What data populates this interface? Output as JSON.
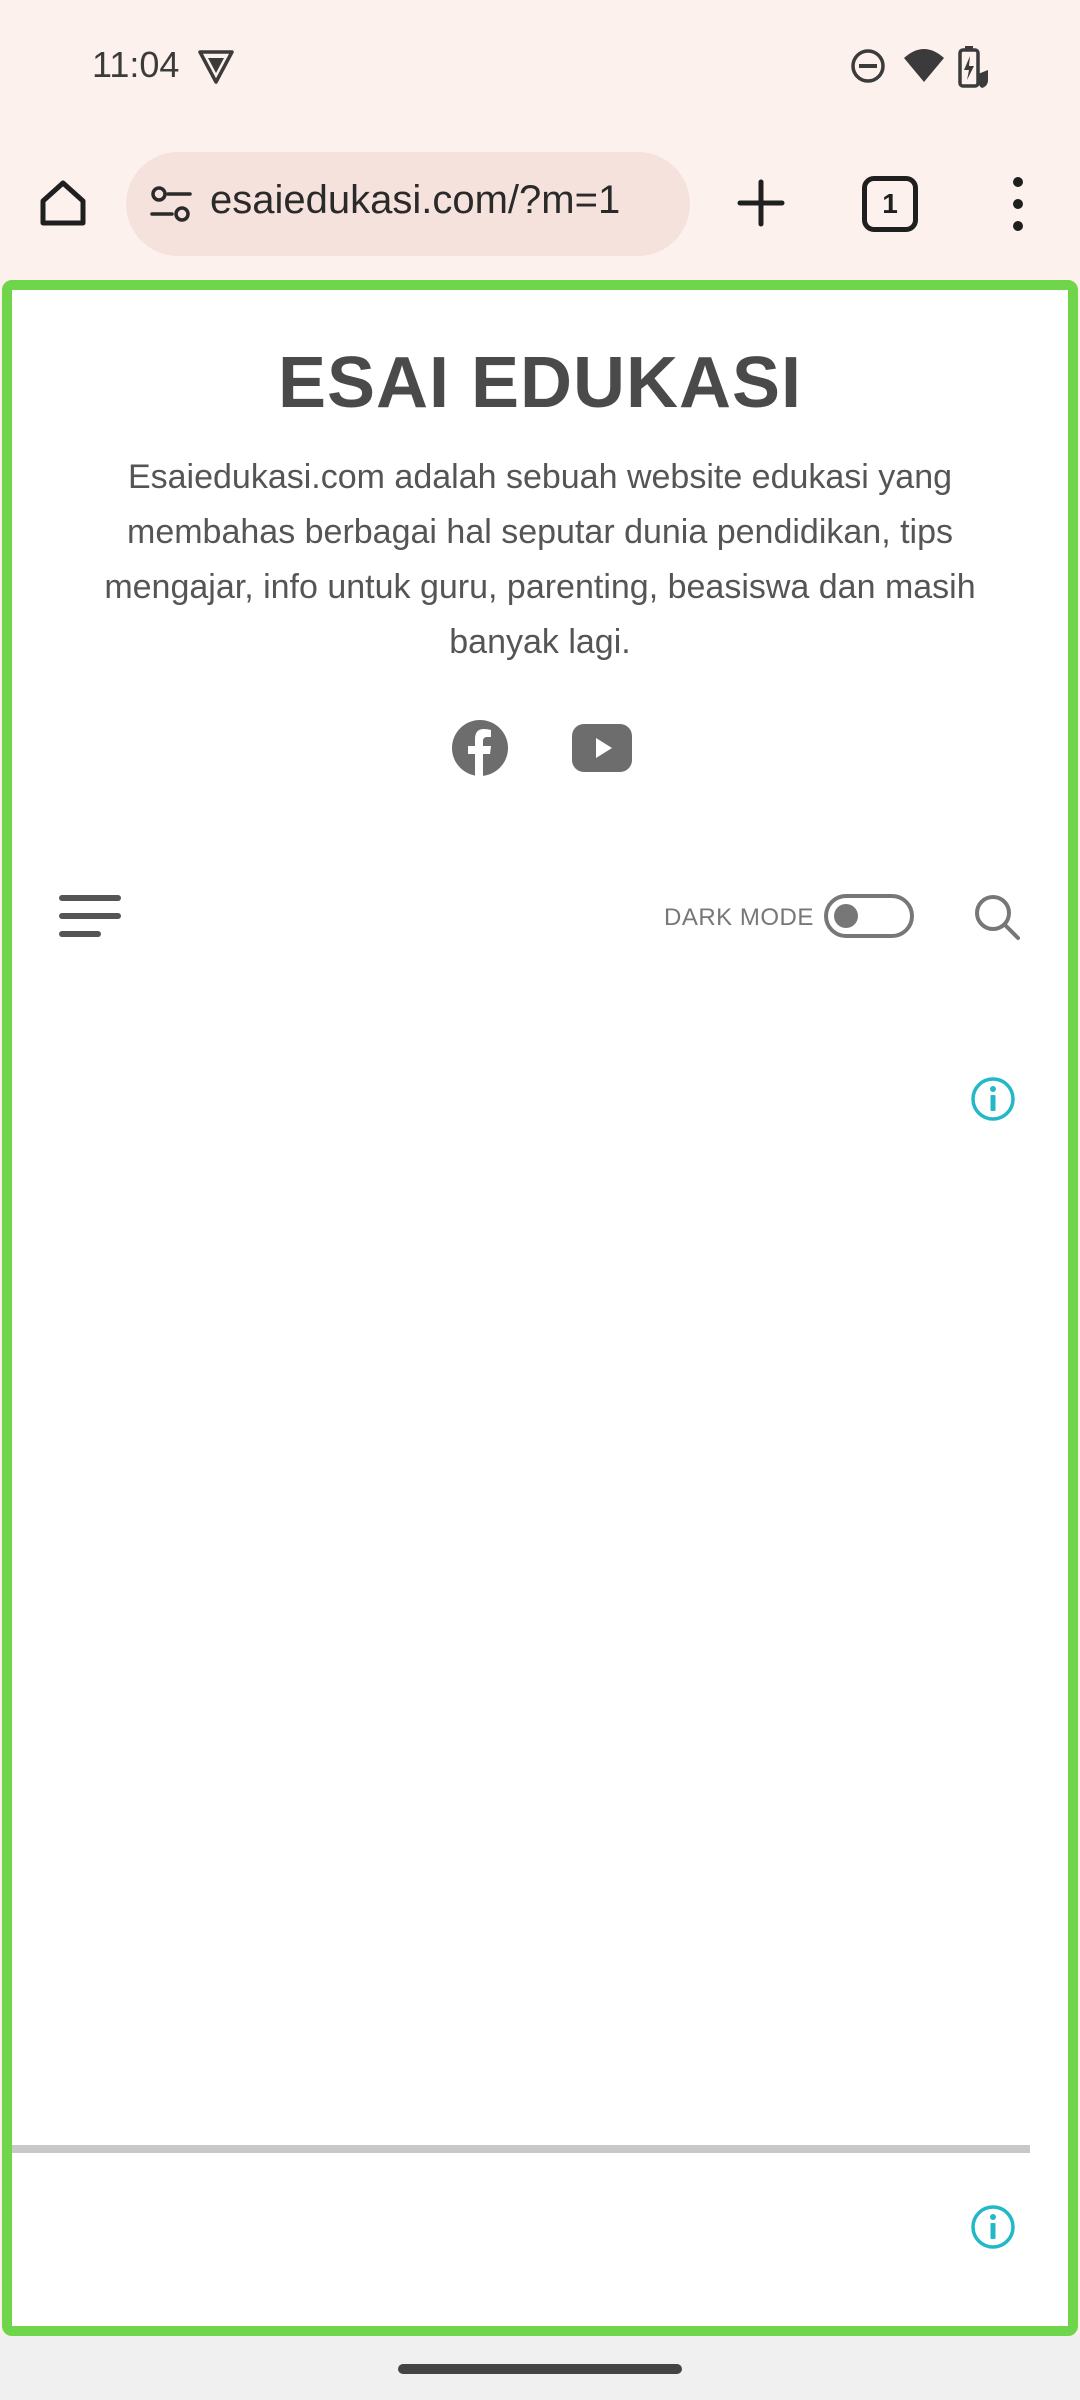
{
  "status_bar": {
    "time": "11:04",
    "icons": [
      "vpn-key-icon",
      "do-not-disturb-icon",
      "wifi-icon",
      "battery-charging-icon"
    ]
  },
  "browser": {
    "url": "esaiedukasi.com/?m=1",
    "tab_count": "1",
    "icons": [
      "home-icon",
      "site-settings-icon",
      "plus-icon",
      "tab-switcher-icon",
      "overflow-menu-icon"
    ]
  },
  "site": {
    "title": "ESAI EDUKASI",
    "description": "Esaiedukasi.com adalah sebuah website edukasi yang membahas berbagai hal seputar dunia pendidikan, tips mengajar, info untuk guru, parenting, beasiswa dan masih banyak lagi.",
    "social_icons": [
      "facebook-icon",
      "youtube-icon"
    ],
    "dark_mode_label": "DARK MODE",
    "dark_mode_on": false
  },
  "colors": {
    "frame_border": "#6fd64b",
    "browser_bg": "#fdf1ee",
    "url_bar_bg": "#f6e2dc",
    "info_icon": "#22b8c8",
    "text_gray": "#4a4a4a"
  }
}
